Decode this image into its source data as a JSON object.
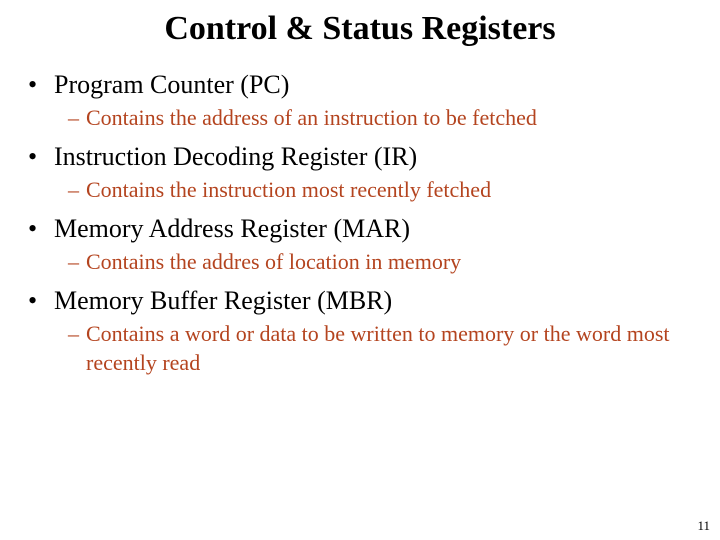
{
  "title": "Control & Status Registers",
  "items": [
    {
      "label": "Program Counter (PC)",
      "desc": "Contains the address of an instruction to be fetched"
    },
    {
      "label": "Instruction Decoding Register (IR)",
      "desc": "Contains the instruction most recently fetched"
    },
    {
      "label": "Memory Address Register (MAR)",
      "desc": "Contains the addres of location in memory"
    },
    {
      "label": "Memory Buffer Register (MBR)",
      "desc": "Contains a word or data to be written to memory or the word most recently read"
    }
  ],
  "page_number": "11"
}
